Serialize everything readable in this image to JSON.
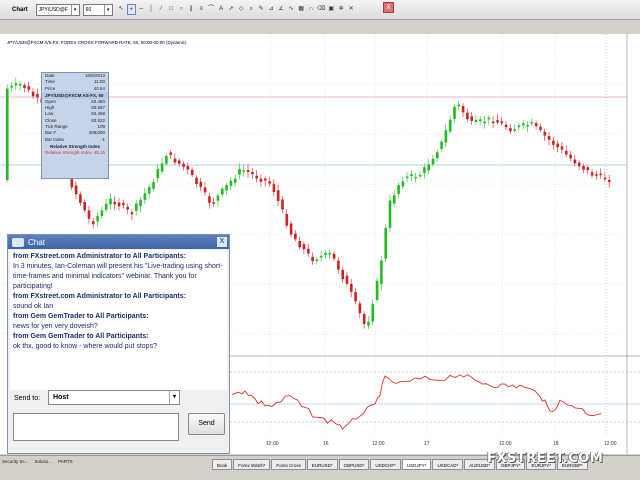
{
  "toolbar": {
    "title": "Chart",
    "symbol": "JPY/USD@F",
    "interval": "60",
    "close_label": "X"
  },
  "chart": {
    "header": "JPY/USD@FXCM A/5-FX, FOREX CROSS FORWARD RATE, 60, 00:00-00:00 (Dynamic)",
    "time_labels": [
      "12:00",
      "16",
      "12:00",
      "17",
      "12:00",
      "18",
      "12:00"
    ]
  },
  "infobox": {
    "rows_top": [
      {
        "k": "Date",
        "v": "10/6/2013"
      },
      {
        "k": "Time",
        "v": "11:00"
      },
      {
        "k": "Price",
        "v": "40.64"
      }
    ],
    "symbol_head": "JPY/USD@FXCM AS-FX, 60",
    "rows_bottom": [
      {
        "k": "Open",
        "v": "83.480"
      },
      {
        "k": "High",
        "v": "83.567"
      },
      {
        "k": "Low",
        "v": "83.458"
      },
      {
        "k": "Close",
        "v": "83.522"
      },
      {
        "k": "Tick Range",
        "v": "109"
      },
      {
        "k": "Bar #",
        "v": "288/300"
      },
      {
        "k": "Bar Index",
        "v": "-1"
      }
    ],
    "rsi_title": "Relative Strength Index",
    "rsi_label": "Relative Strength Index",
    "rsi_value": "45.15"
  },
  "chat": {
    "title": "Chat",
    "close": "X",
    "messages": [
      {
        "from": "from FXstreet.com Administrator to All Participants:",
        "text": "In 3 minutes, Ian-Coleman will present his \"Live-trading using short-time-frames and minimal indicators\" webinar. Thank you for participating!"
      },
      {
        "from": "from FXstreet.com Administrator to All Participants:",
        "text": "sound ok Ian"
      },
      {
        "from": "from Gem GemTrader to All Participants:",
        "text": "news for yen very doveish?"
      },
      {
        "from": "from Gem GemTrader to All Participants:",
        "text": "ok thx, good to know - where would put stops?"
      }
    ],
    "send_to_label": "Send to:",
    "send_to_value": "Host",
    "send_button": "Send"
  },
  "taskbar": {
    "left": [
      "Security Sc...",
      "Solutio...",
      "PARTS"
    ],
    "tabs": [
      "Book",
      "Forex Watch*",
      "Forex Cross",
      "EURUSD*",
      "GBPUSD*",
      "USDCHF*",
      "USDJPY*",
      "USDCAD*",
      "AUDUSD*",
      "GBPJPY*",
      "EURJPY*",
      "EURGBP*"
    ]
  },
  "logo": "FXSTREET.COM",
  "colors": {
    "bull": "#22bb22",
    "bear": "#d02020",
    "rsi": "#e03030",
    "chat_title": "#3d64a8"
  }
}
